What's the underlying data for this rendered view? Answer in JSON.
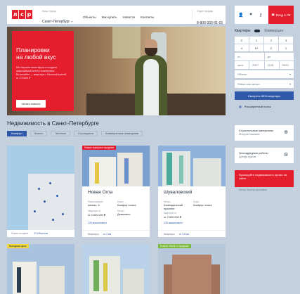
{
  "header": {
    "logo_letters": [
      "л",
      "с",
      "р"
    ],
    "city_caption": "Ваш город",
    "city": "Санкт-Петербург",
    "nav": [
      "Объекты",
      "Как купить",
      "Новости",
      "Контакты"
    ],
    "phone_caption": "Отдел продаж",
    "phone": "8-800-333-01-01",
    "login_label": "Вход в ЛК"
  },
  "hero": {
    "title_line1": "Планировки",
    "title_line2": "на любой вкус",
    "text": "Мы изучили ваши вкусы и создали широчайший спектр планировок. Встречайте — квартиры с большой кухней от 2,5 млн ₽",
    "button": "Читать новость"
  },
  "search": {
    "tab_apartments": "Квартиры",
    "tab_commercial": "Коммерция",
    "rooms": [
      "С",
      "1",
      "2",
      "3",
      "4",
      "5+",
      "С",
      "1"
    ],
    "price_from": "от",
    "price_to": "до",
    "year_from": "срок",
    "years": [
      "2017",
      "2018",
      "2019"
    ],
    "object_placeholder": "Объект",
    "district_placeholder": "Район или метро",
    "show_button": "Смотреть 5524 квартиры",
    "extended_search": "Расширенный поиск"
  },
  "section": {
    "title": "Недвижимость в Санкт-Петербурге",
    "filters": [
      "Комфорт",
      "Бизнес",
      "Элитные",
      "Строящиеся",
      "Коммерческие помещения"
    ]
  },
  "map": {
    "link": "Поиск по карте",
    "count": "22 объектов"
  },
  "projects": [
    {
      "badge": "Новые корпуса в продаже",
      "name": "Новая Охта",
      "price_label": "Квартиры от",
      "price": "от 2 800 000 ₽",
      "class_label": "Класс",
      "class": "Комфорт класс",
      "location_label": "Метро",
      "location": "Девяткино",
      "addr_label": "Расположение",
      "addr": "Автово, 6",
      "link": "228 машиномест",
      "foot": "Квартиры",
      "foot_count": "от 2 км"
    },
    {
      "badge": "",
      "name": "Шуваловский",
      "price_label": "Квартиры от",
      "price": "от 2 600 000 ₽",
      "class_label": "Класс",
      "class": "Комфорт класс",
      "location_label": "Метро",
      "location": "Комендантский проспект",
      "addr_label": "",
      "addr": "",
      "link": "228 машиномест",
      "foot": "Квартиры",
      "foot_count": "от 1,8 км"
    }
  ],
  "services": [
    {
      "title": "Строительные материалы",
      "sub": "Интернет-магазин",
      "icon": "⊕"
    },
    {
      "title": "Генподрядные работы",
      "sub": "Аренда кранов",
      "icon": "⚙"
    }
  ],
  "promo": {
    "text": "Бронируйте недвижимость промо на сайте",
    "sub": "Литер: Быстро Доставка"
  },
  "bottom": {
    "badge1": "Выгодная цена",
    "badge3": "Новый объект в продаже"
  },
  "colors": {
    "brand_red": "#e41e2d",
    "accent_blue": "#2f59a8",
    "page_bg": "#c4d0de"
  }
}
